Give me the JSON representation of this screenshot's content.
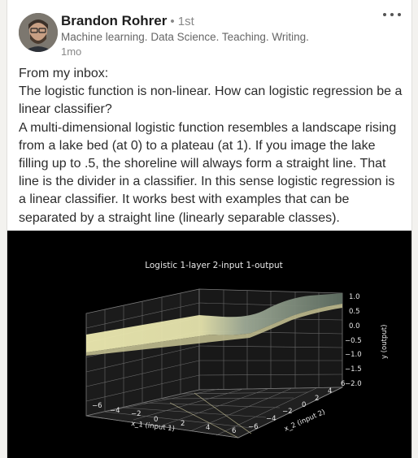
{
  "post": {
    "author": {
      "name": "Brandon Rohrer",
      "degree": "• 1st",
      "headline": "Machine learning. Data Science. Teaching. Writing.",
      "timestamp": "1mo"
    },
    "body": [
      "From my inbox:",
      "The logistic function is non-linear. How can logistic regression be a linear classifier?",
      "A multi-dimensional logistic function resembles a landscape rising from a lake bed (at 0) to a plateau (at 1). If you image the lake filling up to .5, the shoreline will always form a straight line. That line is the divider in a classifier. In this sense logistic regression is a linear classifier. It works best with examples that can be separated by a straight line (linearly separable classes)."
    ],
    "figure": {
      "title": "Logistic 1-layer 2-input 1-output",
      "xlabel": "x_1 (input 1)",
      "ylabel": "x_2 (input 2)",
      "zlabel": "y (output)",
      "x_ticks": [
        "−6",
        "−4",
        "−2",
        "0",
        "2",
        "4",
        "6"
      ],
      "y_ticks": [
        "−6",
        "−4",
        "−2",
        "0",
        "2",
        "4",
        "6"
      ],
      "z_ticks": [
        "1.0",
        "0.5",
        "0.0",
        "−0.5",
        "−1.0",
        "−1.5",
        "−2.0"
      ]
    }
  },
  "colors": {
    "surface_low": "#ece9b0",
    "surface_high": "#5f6e62",
    "grid": "#7a7a7a",
    "text_light": "#e8e8e8"
  },
  "icons": {
    "more": "more-horizontal-icon"
  }
}
